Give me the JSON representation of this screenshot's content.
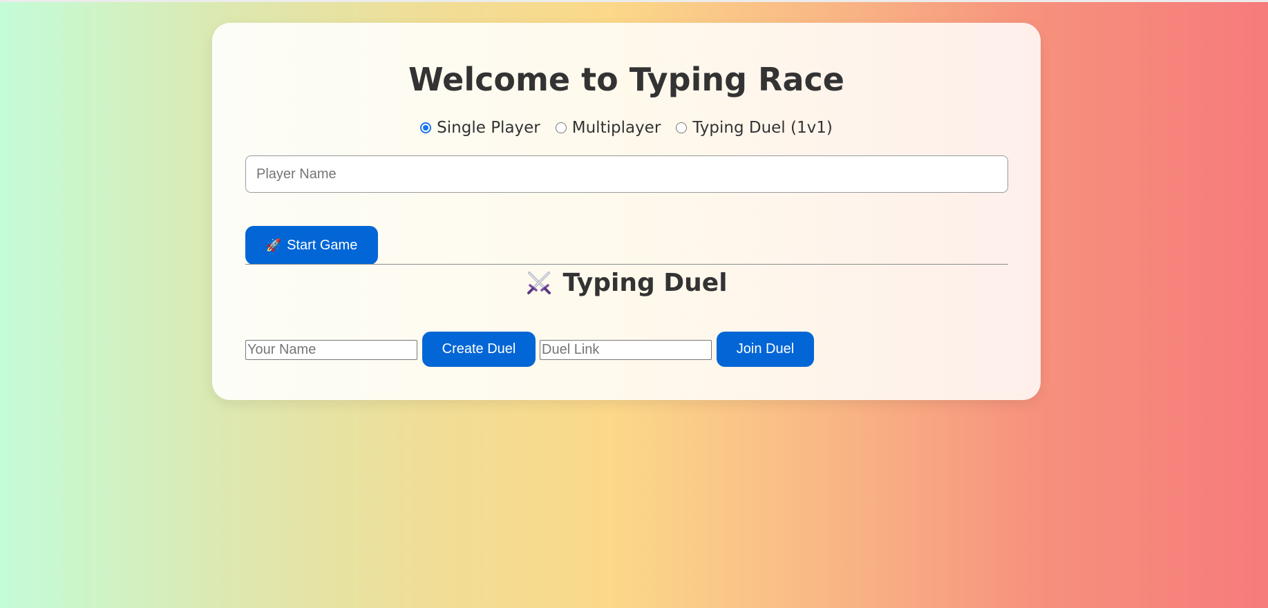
{
  "page": {
    "title": "Welcome to Typing Race"
  },
  "mode_options": [
    {
      "label": "Single Player",
      "selected": true
    },
    {
      "label": "Multiplayer",
      "selected": false
    },
    {
      "label": "Typing Duel (1v1)",
      "selected": false
    }
  ],
  "player_name": {
    "placeholder": "Player Name",
    "value": ""
  },
  "start_button": {
    "icon": "rocket-icon",
    "label": "Start Game"
  },
  "duel": {
    "icon": "crossed-swords-icon",
    "title": "Typing Duel",
    "your_name_placeholder": "Your Name",
    "create_label": "Create Duel",
    "link_placeholder": "Duel Link",
    "join_label": "Join Duel"
  },
  "colors": {
    "accent": "#0366d6",
    "radio_selected": "#1a73e8",
    "text": "#333333"
  }
}
